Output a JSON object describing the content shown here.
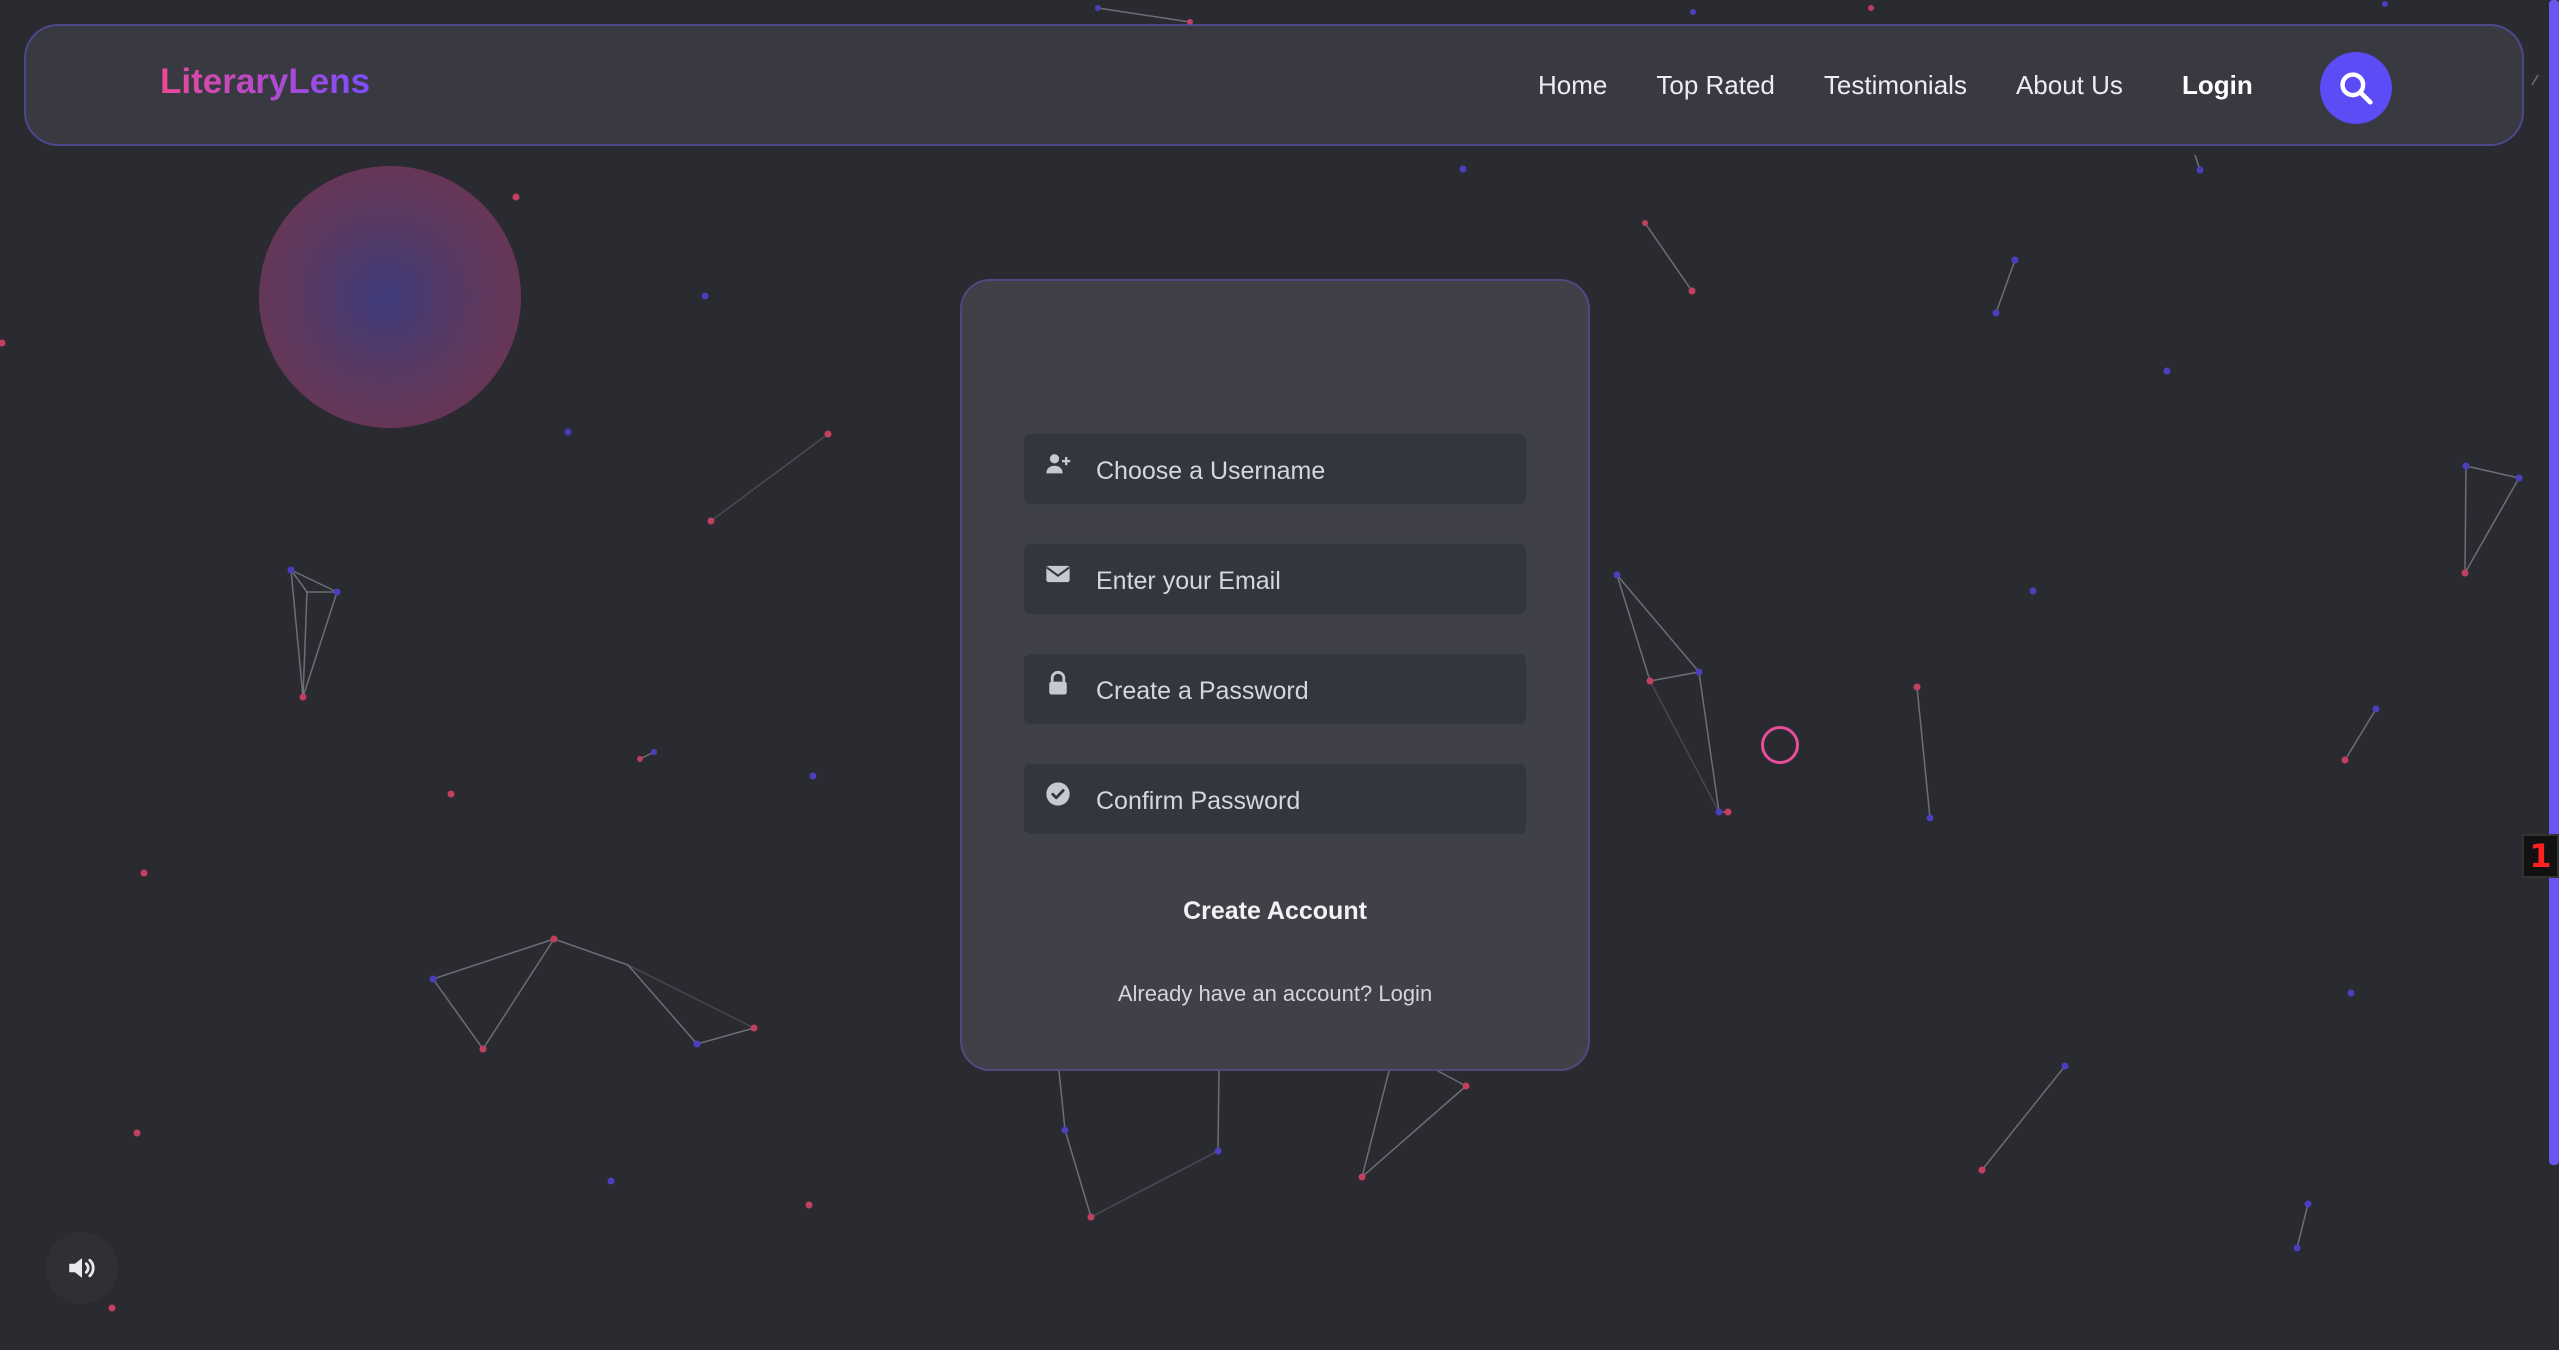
{
  "brand": {
    "name": "LiteraryLens"
  },
  "nav": {
    "links": [
      {
        "label": "Home"
      },
      {
        "label": "Top Rated"
      },
      {
        "label": "Testimonials"
      },
      {
        "label": "About Us"
      }
    ],
    "login_label": "Login",
    "search_icon": "search-icon"
  },
  "signup": {
    "fields": [
      {
        "placeholder": "Choose a Username",
        "type": "text",
        "icon": "user-plus-icon"
      },
      {
        "placeholder": "Enter your Email",
        "type": "email",
        "icon": "envelope-icon"
      },
      {
        "placeholder": "Create a Password",
        "type": "password",
        "icon": "lock-icon"
      },
      {
        "placeholder": "Confirm Password",
        "type": "password",
        "icon": "check-circle-icon"
      }
    ],
    "submit_label": "Create Account",
    "login_prompt": "Already have an account?",
    "login_link": "Login"
  },
  "sound": {
    "icon": "volume-icon"
  },
  "badge": {
    "text": "1"
  },
  "colors": {
    "background": "#2a2a31",
    "accent": "#5b4cf5",
    "brand_gradient_start": "#ec4899",
    "brand_gradient_end": "#7c4dff",
    "dot_pink": "#c2405f",
    "dot_blue": "#4b3fc0"
  }
}
